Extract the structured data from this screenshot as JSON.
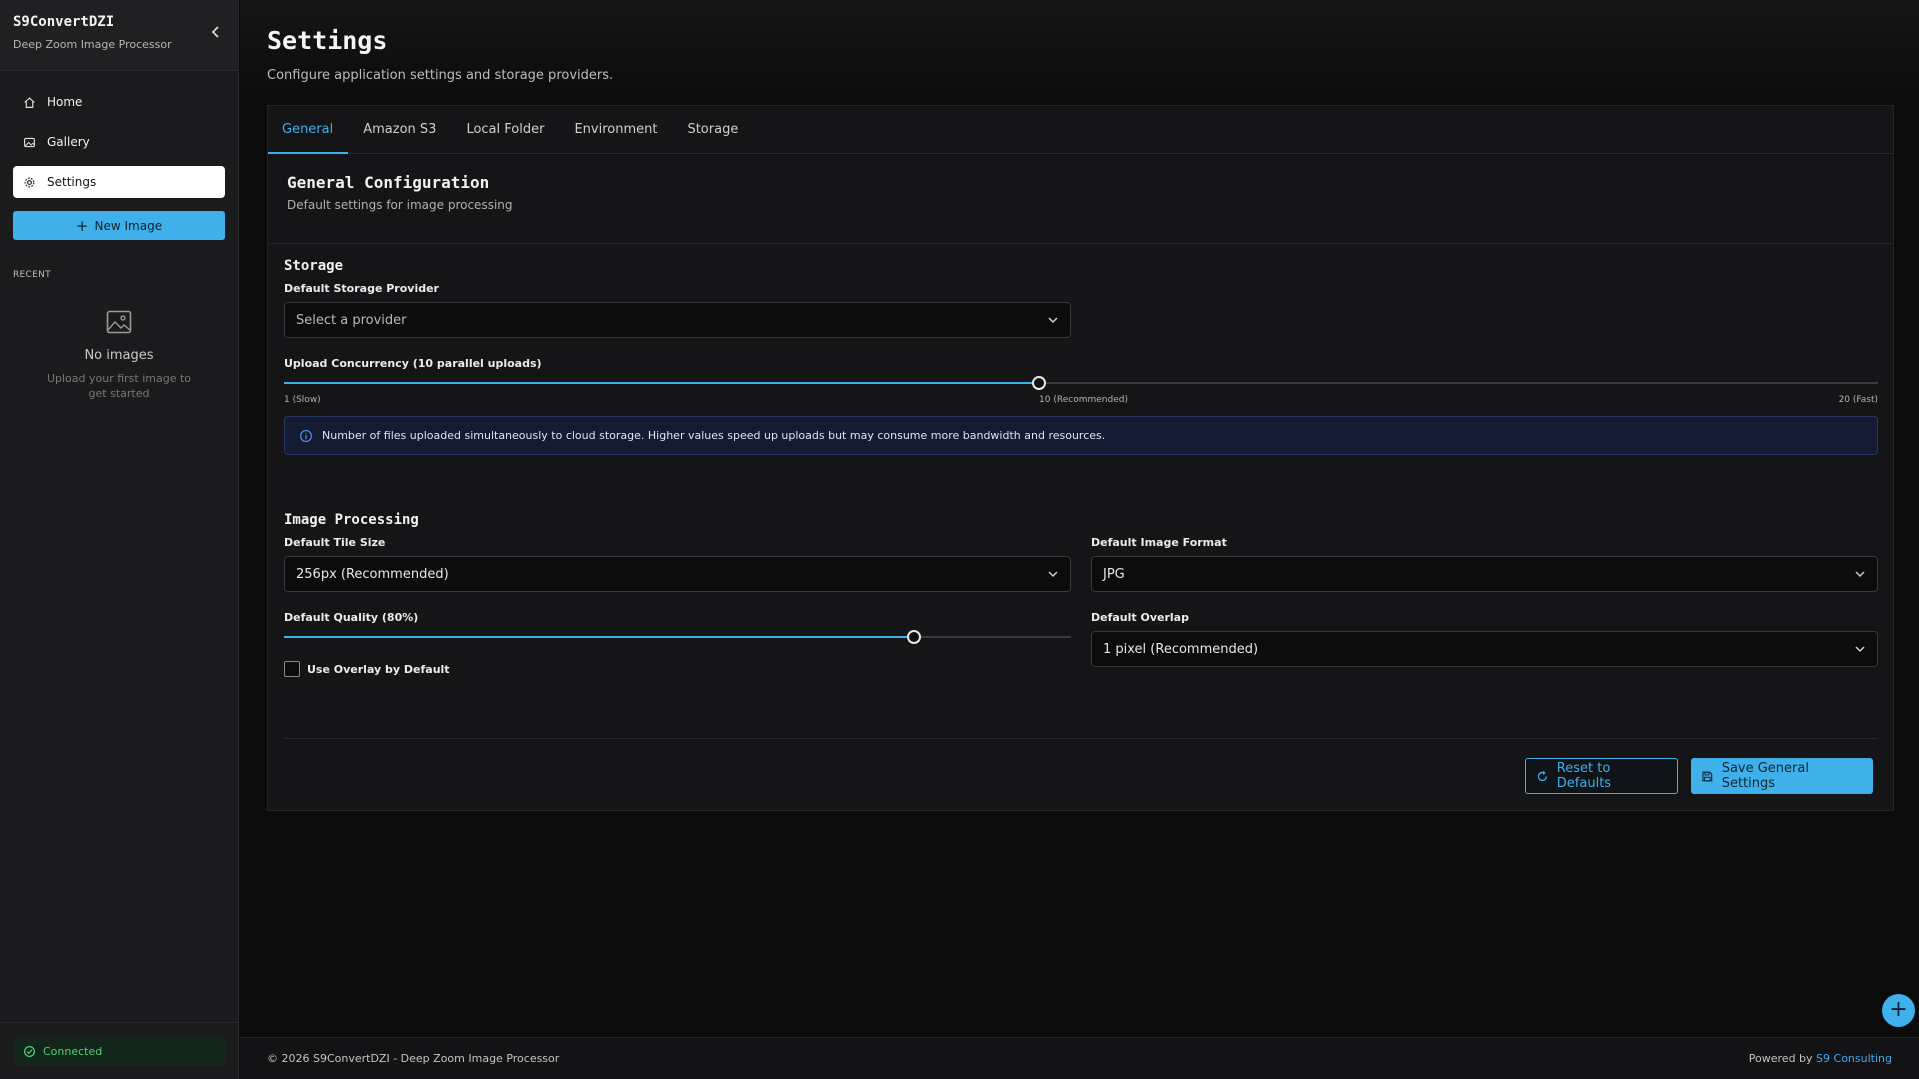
{
  "brand": {
    "title": "S9ConvertDZI",
    "subtitle": "Deep Zoom Image Processor"
  },
  "sidebar": {
    "items": [
      {
        "label": "Home",
        "icon": "home-icon"
      },
      {
        "label": "Gallery",
        "icon": "gallery-icon"
      },
      {
        "label": "Settings",
        "icon": "gear-icon",
        "active": true
      }
    ],
    "new_image_label": "New Image",
    "recent_heading": "RECENT",
    "empty_title": "No images",
    "empty_subtitle": "Upload your first image to get started",
    "status": "Connected"
  },
  "header": {
    "title": "Settings",
    "subtitle": "Configure application settings and storage providers."
  },
  "tabs": [
    "General",
    "Amazon S3",
    "Local Folder",
    "Environment",
    "Storage"
  ],
  "config": {
    "title": "General Configuration",
    "subtitle": "Default settings for image processing"
  },
  "storage": {
    "title": "Storage",
    "provider_label": "Default Storage Provider",
    "provider_placeholder": "Select a provider",
    "concurrency_label": "Upload Concurrency (10 parallel uploads)",
    "concurrency": {
      "min": 1,
      "max": 20,
      "value": 10
    },
    "tick_min": "1 (Slow)",
    "tick_mid": "10 (Recommended)",
    "tick_max": "20 (Fast)",
    "info": "Number of files uploaded simultaneously to cloud storage. Higher values speed up uploads but may consume more bandwidth and resources."
  },
  "processing": {
    "title": "Image Processing",
    "tile_label": "Default Tile Size",
    "tile_value": "256px (Recommended)",
    "format_label": "Default Image Format",
    "format_value": "JPG",
    "quality_label": "Default Quality (80%)",
    "quality": {
      "min": 0,
      "max": 100,
      "value": 80
    },
    "overlap_label": "Default Overlap",
    "overlap_value": "1 pixel (Recommended)",
    "overlay_label": "Use Overlay by Default"
  },
  "actions": {
    "reset": "Reset to Defaults",
    "save": "Save General Settings"
  },
  "footer": {
    "copyright": "© 2026 S9ConvertDZI - Deep Zoom Image Processor",
    "powered": "Powered by",
    "company": "S9 Consulting"
  },
  "colors": {
    "accent": "#3fb0ea",
    "success": "#4ed17a"
  }
}
